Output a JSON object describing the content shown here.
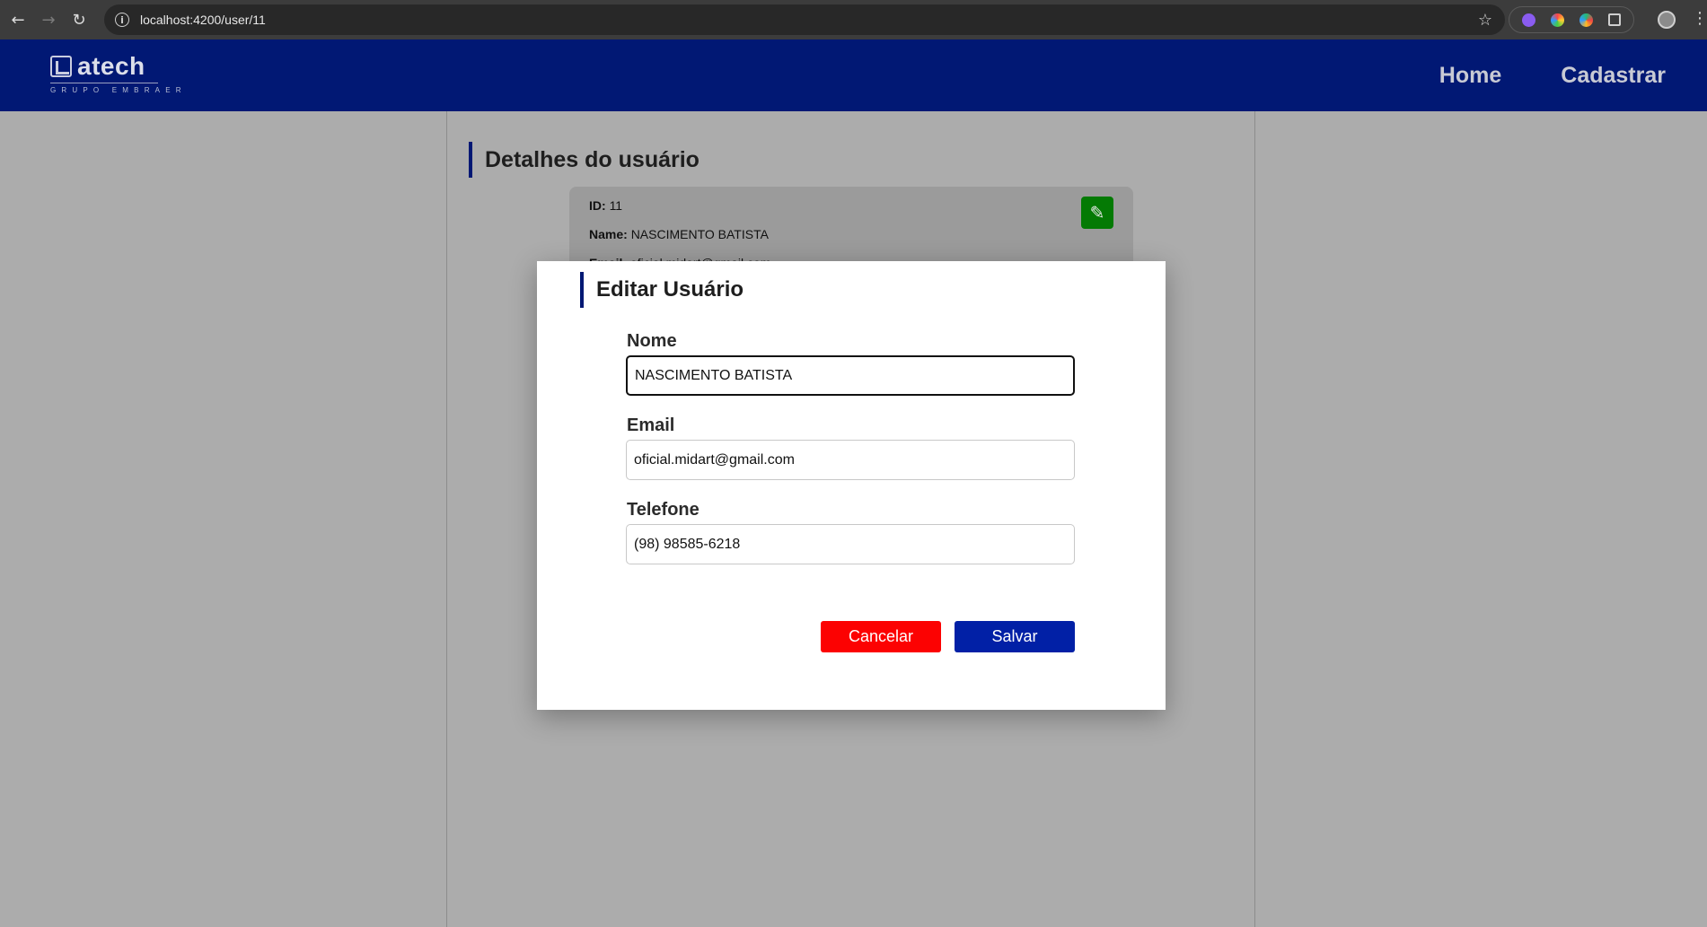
{
  "browser": {
    "url": "localhost:4200/user/11"
  },
  "header": {
    "logo_text": "atech",
    "logo_subtitle": "GRUPO EMBRAER",
    "nav": [
      {
        "label": "Home"
      },
      {
        "label": "Cadastrar"
      }
    ]
  },
  "details": {
    "title": "Detalhes do usuário",
    "id_label": "ID:",
    "id_value": "11",
    "name_label": "Name:",
    "name_value": "NASCIMENTO BATISTA",
    "email_label": "Email:",
    "email_value": "oficial.midart@gmail.com"
  },
  "modal": {
    "title": "Editar Usuário",
    "fields": {
      "nome": {
        "label": "Nome",
        "value": "NASCIMENTO BATISTA"
      },
      "email": {
        "label": "Email",
        "value": "oficial.midart@gmail.com"
      },
      "telefone": {
        "label": "Telefone",
        "value": "(98) 98585-6218"
      }
    },
    "cancel_label": "Cancelar",
    "save_label": "Salvar"
  },
  "colors": {
    "header_bg": "#011874",
    "edit_button": "#047a04",
    "cancel_button": "#fc0202",
    "save_button": "#0120a6"
  },
  "icons": {
    "back": "arrow-left-icon",
    "forward": "arrow-right-icon",
    "reload": "reload-icon",
    "info": "info-icon",
    "bookmark": "star-icon",
    "edit": "pencil-icon",
    "menu": "kebab-menu-icon"
  }
}
